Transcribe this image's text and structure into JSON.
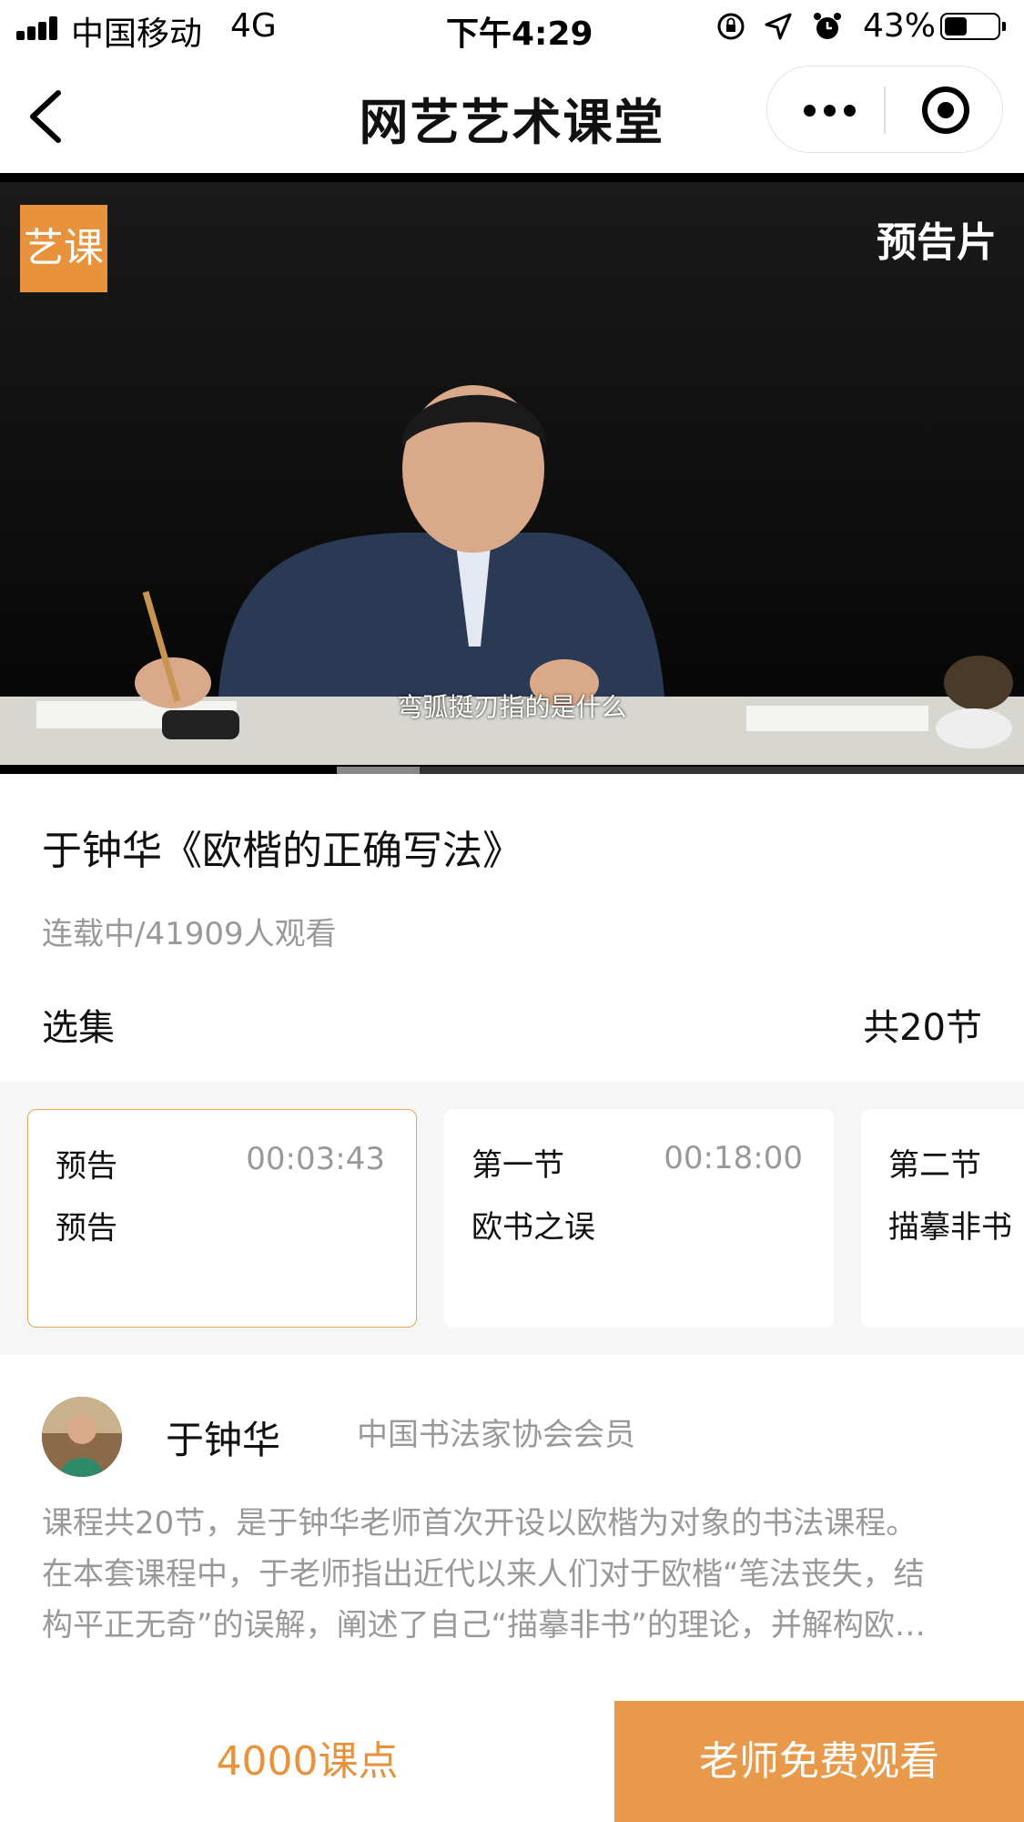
{
  "status_bar": {
    "carrier": "中国移动",
    "network": "4G",
    "time": "下午4:29",
    "battery_percent": "43%",
    "battery_level": 0.43,
    "icons": [
      "signal-icon",
      "orientation-lock-icon",
      "location-icon",
      "alarm-icon",
      "battery-icon"
    ]
  },
  "nav": {
    "title": "网艺艺术课堂",
    "icons": [
      "back-icon",
      "more-icon",
      "target-icon"
    ]
  },
  "video": {
    "logo_text": "艺课",
    "preview_tag": "预告片",
    "subtitle": "弯弧挺刃指的是什么",
    "progress": 0.12
  },
  "course": {
    "title": "于钟华《欧楷的正确写法》",
    "meta": "连载中/41909人观看",
    "episodes_label": "选集",
    "episodes_total": "共20节"
  },
  "episodes": [
    {
      "section": "预告",
      "duration": "00:03:43",
      "name": "预告",
      "active": true
    },
    {
      "section": "第一节",
      "duration": "00:18:00",
      "name": "欧书之误",
      "active": false
    },
    {
      "section": "第二节",
      "duration": "",
      "name": "描摹非书",
      "active": false
    }
  ],
  "teacher": {
    "name": "于钟华",
    "role": "中国书法家协会会员",
    "description_lines": [
      "课程共20节，是于钟华老师首次开设以欧楷为对象的书法课程。",
      "在本套课程中，于老师指出近代以来人们对于欧楷“笔法丧失，结",
      "构平正无奇”的误解，阐述了自己“描摹非书”的理论，并解构欧…"
    ]
  },
  "bottom_bar": {
    "price": "4000课点",
    "cta": "老师免费观看"
  },
  "colors": {
    "accent": "#e8923c",
    "cta_bg": "#e89a4a",
    "muted_text": "#999999",
    "strip_bg": "#f6f6f6"
  }
}
